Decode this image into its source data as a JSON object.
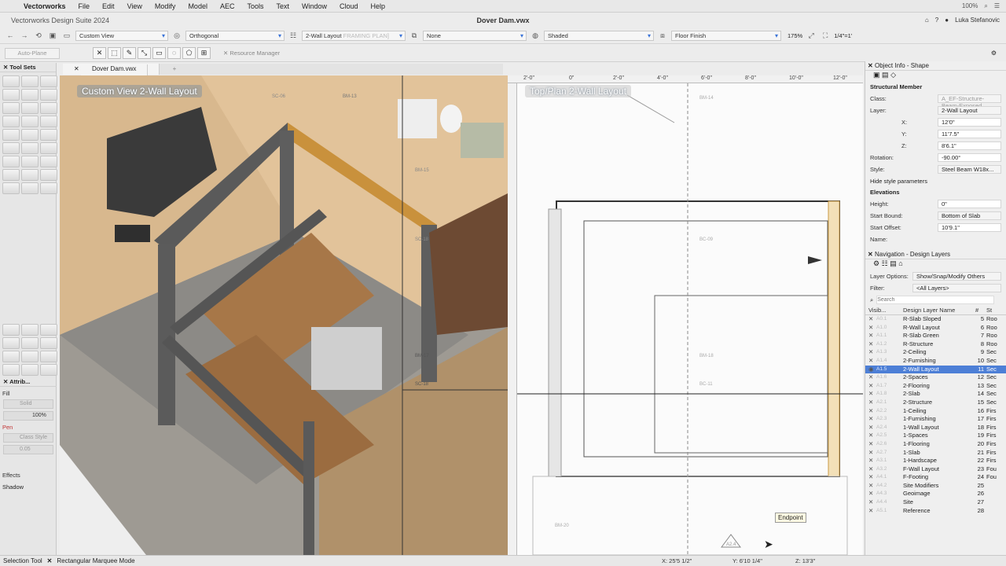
{
  "menubar": {
    "app": "Vectorworks",
    "items": [
      "File",
      "Edit",
      "View",
      "Modify",
      "Model",
      "AEC",
      "Tools",
      "Text",
      "Window",
      "Cloud",
      "Help"
    ],
    "zoom_pct": "100%"
  },
  "window": {
    "app_title": "Vectorworks Design Suite 2024",
    "doc_title": "Dover Dam.vwx",
    "user": "Luka Stefanovic"
  },
  "viewbar": {
    "view": "Custom View",
    "projection": "Orthogonal",
    "layer": "2-Wall Layout",
    "layer_ghost": "FRAMING PLAN]",
    "clip": "None",
    "render": "Shaded",
    "story_level": "Floor Finish",
    "zoom": "175%",
    "scale": "1/4\"=1'"
  },
  "modebar": {
    "auto_plane": "Auto-Plane",
    "resource_manager": "Resource Manager"
  },
  "tool_sets": {
    "title": "Tool Sets"
  },
  "attributes": {
    "title": "Attrib...",
    "fill_label": "Fill",
    "fill_value": "Solid",
    "opacity": "100%",
    "pen_label": "Pen",
    "pen_value": "Class Style",
    "line_value": "0.05",
    "effects_label": "Effects",
    "shadow_label": "Shadow"
  },
  "doc_tab": "Dover Dam.vwx",
  "pane_left_label": "Custom View  2-Wall Layout",
  "pane_right_label": "Top/Plan  2-Wall Layout",
  "ruler_ticks": [
    "2'-0\"",
    "0\"",
    "2'-0\"",
    "4'-0\"",
    "6'-0\"",
    "8'-0\"",
    "10'-0\"",
    "12'-0\""
  ],
  "plan_tags": [
    "BM-14",
    "BC-09",
    "BM-18",
    "BC-11",
    "BM-20",
    "A2.4"
  ],
  "model_tags": [
    "SC-06",
    "BM-13",
    "BM-15",
    "SC-18",
    "BM-17",
    "SC-18"
  ],
  "endpoint_label": "Endpoint",
  "object_info": {
    "title": "Object Info - Shape",
    "object_type": "Structural Member",
    "class_label": "Class:",
    "class_value": "A_EF-Structure-Beam-Exposed",
    "layer_label": "Layer:",
    "layer_value": "2-Wall Layout",
    "x": "12'0\"",
    "y": "11'7.5\"",
    "z": "8'6.1\"",
    "rotation_label": "Rotation:",
    "rotation_value": "-90.00°",
    "style_label": "Style:",
    "style_value": "Steel Beam W18x...",
    "hide_style": "Hide style parameters",
    "elevations_label": "Elevations",
    "height_label": "Height:",
    "height_value": "0\"",
    "start_bound_label": "Start Bound:",
    "start_bound_value": "Bottom of Slab",
    "start_offset_label": "Start Offset:",
    "start_offset_value": "10'9.1\"",
    "name_label": "Name:"
  },
  "navigation": {
    "title": "Navigation - Design Layers",
    "layer_options_label": "Layer Options:",
    "layer_options_value": "Show/Snap/Modify Others",
    "filter_label": "Filter:",
    "filter_value": "<All Layers>",
    "search_placeholder": "Search",
    "col_visibility": "Visib...",
    "col_name": "Design Layer Name",
    "col_num": "#",
    "col_story": "St",
    "rows": [
      {
        "sheet": "A0.1",
        "name": "R-Slab Sloped",
        "num": "5",
        "story": "Roo",
        "active": false
      },
      {
        "sheet": "A1.0",
        "name": "R-Wall Layout",
        "num": "6",
        "story": "Roo",
        "active": false
      },
      {
        "sheet": "A1.1",
        "name": "R-Slab Green",
        "num": "7",
        "story": "Roo",
        "active": false
      },
      {
        "sheet": "A1.2",
        "name": "R-Structure",
        "num": "8",
        "story": "Roo",
        "active": false
      },
      {
        "sheet": "A1.3",
        "name": "2-Ceiling",
        "num": "9",
        "story": "Sec",
        "active": false
      },
      {
        "sheet": "A1.4",
        "name": "2-Furnishing",
        "num": "10",
        "story": "Sec",
        "active": false
      },
      {
        "sheet": "A1.5",
        "name": "2-Wall Layout",
        "num": "11",
        "story": "Sec",
        "active": true
      },
      {
        "sheet": "A1.6",
        "name": "2-Spaces",
        "num": "12",
        "story": "Sec",
        "active": false
      },
      {
        "sheet": "A1.7",
        "name": "2-Flooring",
        "num": "13",
        "story": "Sec",
        "active": false
      },
      {
        "sheet": "A1.8",
        "name": "2-Slab",
        "num": "14",
        "story": "Sec",
        "active": false
      },
      {
        "sheet": "A2.1",
        "name": "2-Structure",
        "num": "15",
        "story": "Sec",
        "active": false
      },
      {
        "sheet": "A2.2",
        "name": "1-Ceiling",
        "num": "16",
        "story": "Firs",
        "active": false
      },
      {
        "sheet": "A2.3",
        "name": "1-Furnishing",
        "num": "17",
        "story": "Firs",
        "active": false
      },
      {
        "sheet": "A2.4",
        "name": "1-Wall Layout",
        "num": "18",
        "story": "Firs",
        "active": false
      },
      {
        "sheet": "A2.5",
        "name": "1-Spaces",
        "num": "19",
        "story": "Firs",
        "active": false
      },
      {
        "sheet": "A2.6",
        "name": "1-Flooring",
        "num": "20",
        "story": "Firs",
        "active": false
      },
      {
        "sheet": "A2.7",
        "name": "1-Slab",
        "num": "21",
        "story": "Firs",
        "active": false
      },
      {
        "sheet": "A3.1",
        "name": "1-Hardscape",
        "num": "22",
        "story": "Firs",
        "active": false
      },
      {
        "sheet": "A3.2",
        "name": "F-Wall Layout",
        "num": "23",
        "story": "Fou",
        "active": false
      },
      {
        "sheet": "A4.1",
        "name": "F-Footing",
        "num": "24",
        "story": "Fou",
        "active": false
      },
      {
        "sheet": "A4.2",
        "name": "Site Modifiers",
        "num": "25",
        "story": "",
        "active": false
      },
      {
        "sheet": "A4.3",
        "name": "Geoimage",
        "num": "26",
        "story": "",
        "active": false
      },
      {
        "sheet": "A4.4",
        "name": "Site",
        "num": "27",
        "story": "",
        "active": false
      },
      {
        "sheet": "A5.1",
        "name": "Reference",
        "num": "28",
        "story": "",
        "active": false
      }
    ]
  },
  "status": {
    "tool": "Selection Tool",
    "mode": "Rectangular Marquee Mode",
    "x": "X: 25'5 1/2\"",
    "y": "Y: 6'10 1/4\"",
    "z": "Z: 13'3\""
  }
}
